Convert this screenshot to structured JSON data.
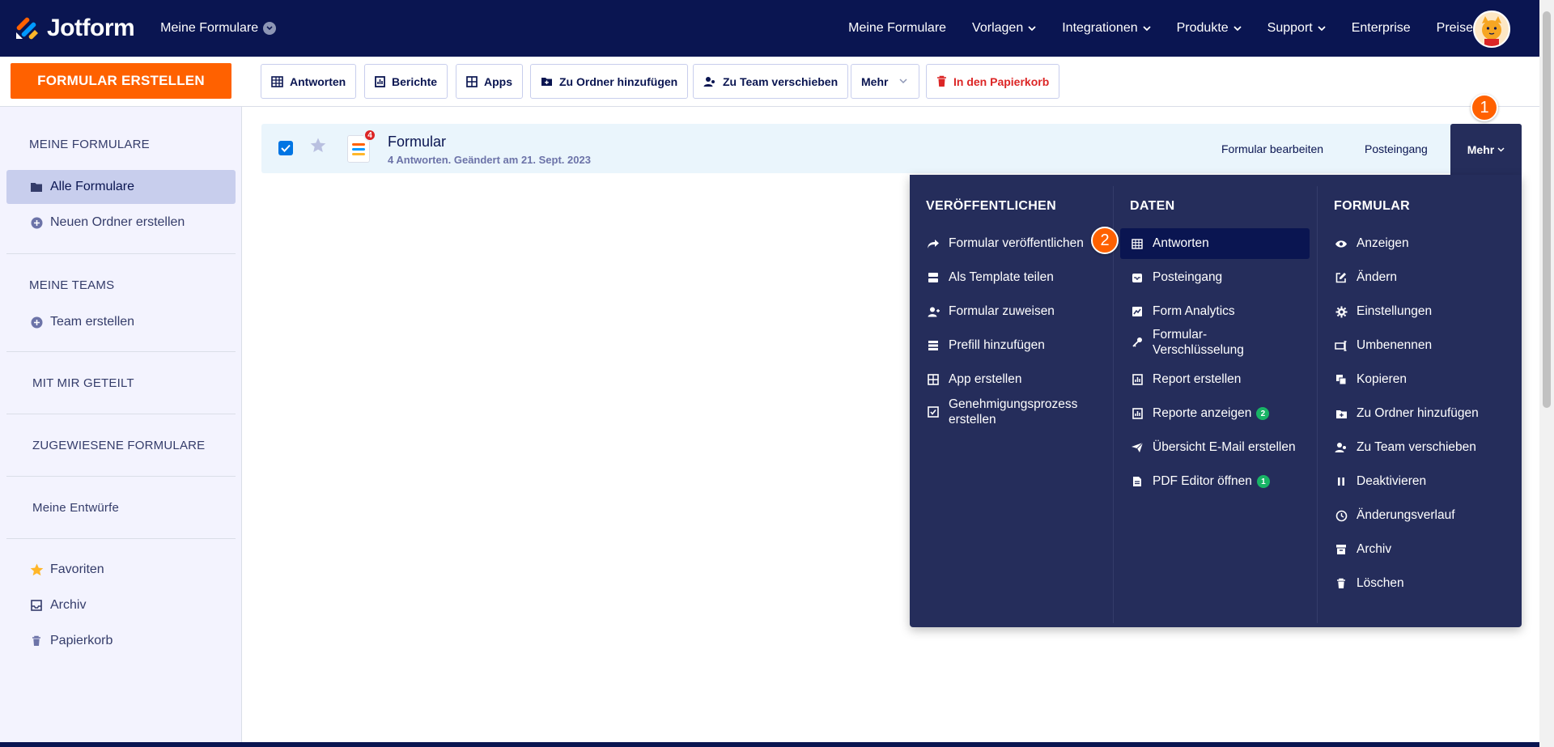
{
  "app": {
    "brand": "Jotform",
    "workspace": "Meine Formulare"
  },
  "nav": {
    "items": [
      {
        "label": "Meine Formulare",
        "dropdown": false
      },
      {
        "label": "Vorlagen",
        "dropdown": true
      },
      {
        "label": "Integrationen",
        "dropdown": true
      },
      {
        "label": "Produkte",
        "dropdown": true
      },
      {
        "label": "Support",
        "dropdown": true
      },
      {
        "label": "Enterprise",
        "dropdown": false
      },
      {
        "label": "Preise",
        "dropdown": false
      }
    ]
  },
  "toolbar": {
    "create_label": "FORMULAR ERSTELLEN",
    "responses": "Antworten",
    "reports": "Berichte",
    "apps": "Apps",
    "add_folder": "Zu Ordner hinzufügen",
    "move_team": "Zu Team verschieben",
    "more": "Mehr",
    "trash": "In den Papierkorb"
  },
  "sidebar": {
    "my_forms_heading": "MEINE FORMULARE",
    "all_forms": "Alle Formulare",
    "new_folder": "Neuen Ordner erstellen",
    "my_teams_heading": "MEINE TEAMS",
    "create_team": "Team erstellen",
    "shared_heading": "MIT MIR GETEILT",
    "assigned_heading": "ZUGEWIESENE FORMULARE",
    "drafts": "Meine Entwürfe",
    "favorites": "Favoriten",
    "archive": "Archiv",
    "trash": "Papierkorb"
  },
  "form_row": {
    "title": "Formular",
    "meta": "4 Antworten. Geändert am 21. Sept. 2023",
    "badge_count": "4",
    "edit": "Formular bearbeiten",
    "inbox": "Posteingang",
    "more": "Mehr"
  },
  "steps": {
    "one": "1",
    "two": "2"
  },
  "menu": {
    "publish": {
      "heading": "VERÖFFENTLICHEN",
      "items": [
        "Formular veröffentlichen",
        "Als Template teilen",
        "Formular zuweisen",
        "Prefill hinzufügen",
        "App erstellen",
        "Genehmigungsprozess erstellen"
      ]
    },
    "data": {
      "heading": "DATEN",
      "items": [
        "Antworten",
        "Posteingang",
        "Form Analytics",
        "Formular-Verschlüsselung",
        "Report erstellen",
        "Reporte anzeigen",
        "Übersicht E-Mail erstellen",
        "PDF Editor öffnen"
      ],
      "reports_count": "2",
      "pdf_count": "1"
    },
    "form": {
      "heading": "FORMULAR",
      "items": [
        "Anzeigen",
        "Ändern",
        "Einstellungen",
        "Umbenennen",
        "Kopieren",
        "Zu Ordner hinzufügen",
        "Zu Team verschieben",
        "Deaktivieren",
        "Änderungsverlauf",
        "Archiv",
        "Löschen"
      ]
    }
  },
  "colors": {
    "navy": "#0a1551",
    "orange": "#ff6100",
    "menu_bg": "#252d5b",
    "sidebar_bg": "#f3f3fe",
    "row_bg": "#eaf5fc",
    "danger": "#dc2626",
    "green": "#18b466"
  }
}
